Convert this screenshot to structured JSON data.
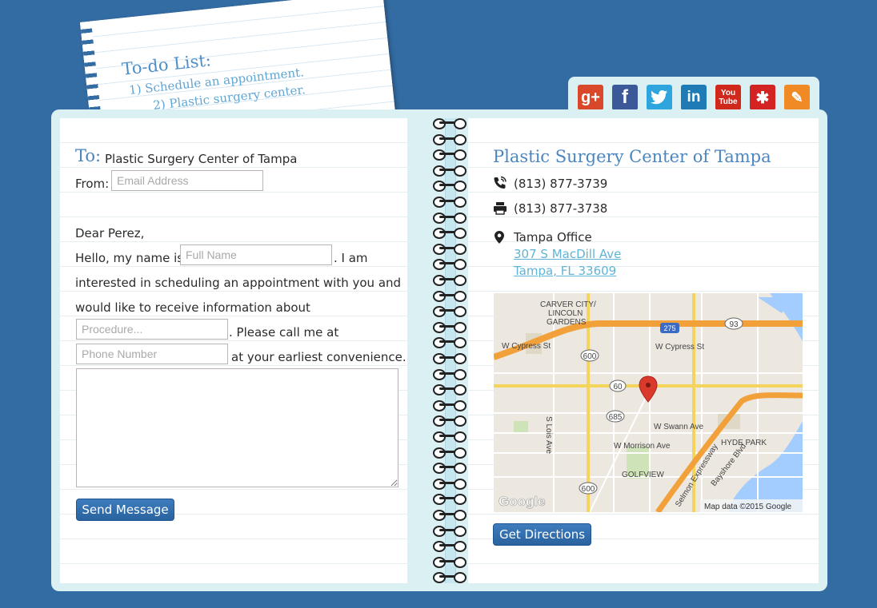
{
  "note": {
    "title": "To-do List:",
    "line1": "1) Schedule an appointment.",
    "line2": "2) Plastic surgery center."
  },
  "social": {
    "icons": [
      "google-plus-icon",
      "facebook-icon",
      "twitter-icon",
      "linkedin-icon",
      "youtube-icon",
      "yelp-icon",
      "blog-icon"
    ],
    "colors": {
      "google": "#d9482b",
      "facebook": "#3b5998",
      "twitter": "#2fa5dd",
      "linkedin": "#1f7bb6",
      "youtube": "#d0281b",
      "yelp": "#d32323",
      "blog": "#f08a24"
    },
    "youtube_top": "You",
    "youtube_bottom": "Tube"
  },
  "form": {
    "to_label": "To:",
    "to_value": "Plastic Surgery Center of Tampa",
    "from_label": "From:",
    "email_placeholder": "Email Address",
    "greeting": "Dear Perez,",
    "hello": "Hello, my name is",
    "name_placeholder": "Full Name",
    "i_am": ". I am",
    "line3": "interested in scheduling an appointment with you and",
    "line4": "would like to receive information about",
    "procedure_placeholder": "Procedure...",
    "please_call": ". Please call me at",
    "phone_placeholder": "Phone Number",
    "convenience": "at your earliest convenience.",
    "send_label": "Send Message"
  },
  "business": {
    "name": "Plastic Surgery Center of Tampa",
    "phone": "(813) 877-3739",
    "fax": "(813) 877-3738",
    "office_name": "Tampa Office",
    "address1": "307 S MacDill Ave",
    "address2": "Tampa, FL 33609",
    "directions_label": "Get Directions"
  },
  "map": {
    "labels": {
      "carver": "CARVER CITY/",
      "lincoln": "LINCOLN",
      "gardens": "GARDENS",
      "cypress_w": "W Cypress St",
      "cypress_e": "W Cypress St",
      "swann": "W Swann Ave",
      "morrison": "W Morrison Ave",
      "lois": "S Lois Ave",
      "hyde": "HYDE PARK",
      "bayshore": "Bayshore Blvd",
      "golfview": "GOLFVIEW",
      "selmon": "Selmon Expressway",
      "i275": "275",
      "r93": "93",
      "r600a": "600",
      "r600b": "600",
      "r60": "60",
      "r685": "685",
      "google": "Google",
      "attribution": "Map data ©2015 Google"
    }
  }
}
